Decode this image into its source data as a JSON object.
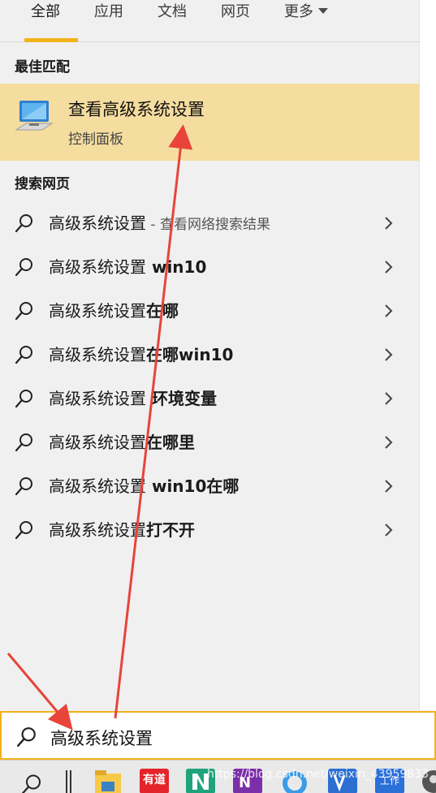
{
  "tabs": [
    {
      "label": "全部",
      "active": true
    },
    {
      "label": "应用",
      "active": false
    },
    {
      "label": "文档",
      "active": false
    },
    {
      "label": "网页",
      "active": false
    },
    {
      "label": "更多",
      "active": false
    }
  ],
  "best_match": {
    "header": "最佳匹配",
    "title": "查看高级系统设置",
    "subtitle": "控制面板",
    "icon": "monitor-settings-icon"
  },
  "web": {
    "header": "搜索网页",
    "results": [
      {
        "prefix": "高级系统设置",
        "suffix": "",
        "hint": " - 查看网络搜索结果"
      },
      {
        "prefix": "高级系统设置",
        "suffix": " win10",
        "hint": ""
      },
      {
        "prefix": "高级系统设置",
        "suffix": "在哪",
        "hint": ""
      },
      {
        "prefix": "高级系统设置",
        "suffix": "在哪win10",
        "hint": ""
      },
      {
        "prefix": "高级系统设置",
        "suffix": " 环境变量",
        "hint": ""
      },
      {
        "prefix": "高级系统设置",
        "suffix": "在哪里",
        "hint": ""
      },
      {
        "prefix": "高级系统设置",
        "suffix": " win10在哪",
        "hint": ""
      },
      {
        "prefix": "高级系统设置",
        "suffix": "打不开",
        "hint": ""
      }
    ]
  },
  "search": {
    "query": "高级系统设置"
  },
  "taskbar": {
    "items": [
      "search-icon",
      "task-view-icon",
      "file-explorer-icon",
      "youdao-icon",
      "nvidia-icon",
      "onenote-icon",
      "chat-icon",
      "visio-icon",
      "work-icon",
      "avatar-icon"
    ],
    "youdao_label": "有道",
    "work_label": "工作"
  },
  "watermark": "https://blog.csdn.net/weixin_43959833",
  "colors": {
    "accent": "#f3b21c",
    "highlight": "#f5dd9f",
    "annotation": "#e8443a"
  }
}
